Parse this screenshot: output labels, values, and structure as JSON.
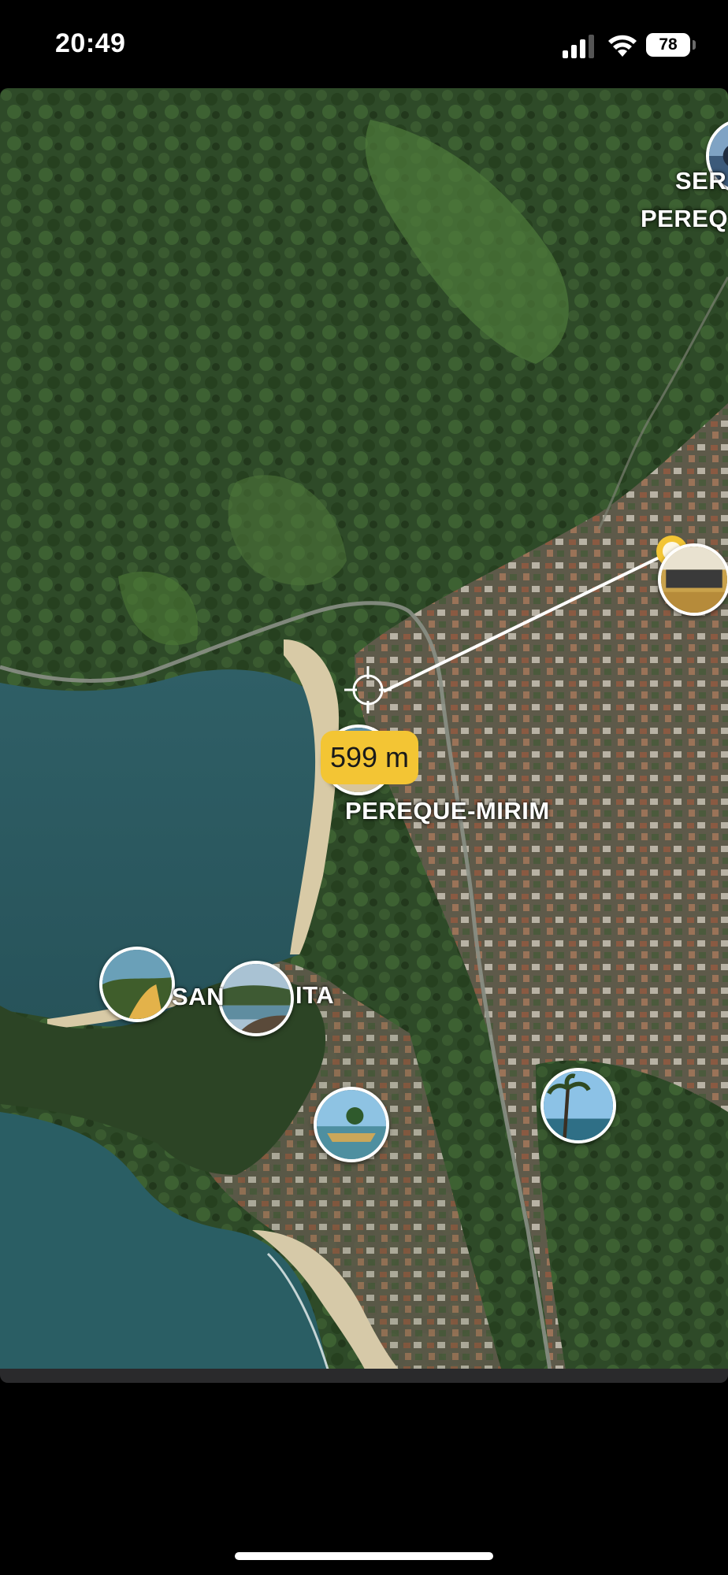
{
  "status_bar": {
    "time": "20:49",
    "battery": "78",
    "icons": [
      "signal-icon",
      "wifi-icon",
      "battery-icon"
    ]
  },
  "map": {
    "view": "satellite",
    "labels": {
      "pereque_mirim": "PEREQUE-MIRIM",
      "santa_rita_left": "SAN",
      "santa_rita_right": "ITA",
      "top_right_line1": "SER",
      "top_right_line2": "PEREQ"
    },
    "measurement": {
      "distance": "599 m",
      "line_color": "#ffffff",
      "badge_color": "#f3c534"
    },
    "icons": [
      "crosshair-icon",
      "endpoint-marker-icon"
    ],
    "photo_pins": [
      "photo-pin-top-right",
      "photo-pin-endpoint",
      "photo-pin-beach",
      "photo-pin-santa-rita-1",
      "photo-pin-santa-rita-2",
      "photo-pin-boat",
      "photo-pin-palm"
    ]
  }
}
